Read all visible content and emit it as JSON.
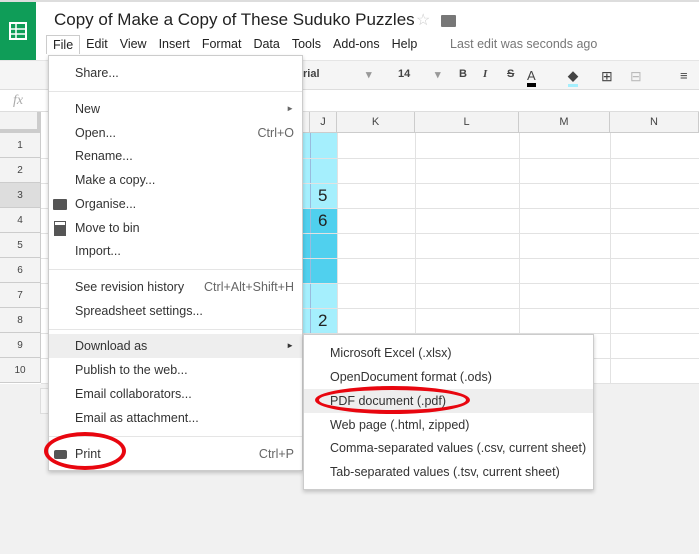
{
  "doc": {
    "title": "Copy of Make a Copy of These Suduko Puzzles",
    "last_edit": "Last edit was seconds ago"
  },
  "menubar": [
    "File",
    "Edit",
    "View",
    "Insert",
    "Format",
    "Data",
    "Tools",
    "Add-ons",
    "Help"
  ],
  "toolbar": {
    "font": "rial",
    "font_size": "14",
    "bold": "B",
    "italic": "I",
    "strike": "S",
    "text_color": "A"
  },
  "formula_bar": {
    "fx": "fx"
  },
  "columns": [
    "J",
    "K",
    "L",
    "M",
    "N"
  ],
  "rows": [
    "1",
    "2",
    "3",
    "4",
    "5",
    "6",
    "7",
    "8",
    "9",
    "10"
  ],
  "cells": {
    "j3": "5",
    "j4": "6",
    "j8": "2"
  },
  "file_menu": {
    "items": [
      {
        "label": "Share..."
      },
      {
        "label": "New",
        "submenu": true
      },
      {
        "label": "Open...",
        "shortcut": "Ctrl+O"
      },
      {
        "label": "Rename..."
      },
      {
        "label": "Make a copy..."
      },
      {
        "label": "Organise...",
        "icon": "folder-icon"
      },
      {
        "label": "Move to bin",
        "icon": "trash-icon"
      },
      {
        "label": "Import..."
      },
      {
        "label": "See revision history",
        "shortcut": "Ctrl+Alt+Shift+H"
      },
      {
        "label": "Spreadsheet settings..."
      },
      {
        "label": "Download as",
        "submenu": true,
        "highlighted": true
      },
      {
        "label": "Publish to the web..."
      },
      {
        "label": "Email collaborators..."
      },
      {
        "label": "Email as attachment..."
      },
      {
        "label": "Print",
        "shortcut": "Ctrl+P",
        "icon": "printer-icon"
      }
    ]
  },
  "download_menu": {
    "items": [
      "Microsoft Excel (.xlsx)",
      "OpenDocument format (.ods)",
      "PDF document (.pdf)",
      "Web page (.html, zipped)",
      "Comma-separated values (.csv, current sheet)",
      "Tab-separated values (.tsv, current sheet)"
    ],
    "highlighted": "PDF document (.pdf)"
  },
  "colors": {
    "brand": "#0f9d58",
    "highlight_ring": "#e8060f",
    "cell_light": "#a5effd",
    "cell_dark": "#50d0ee"
  }
}
